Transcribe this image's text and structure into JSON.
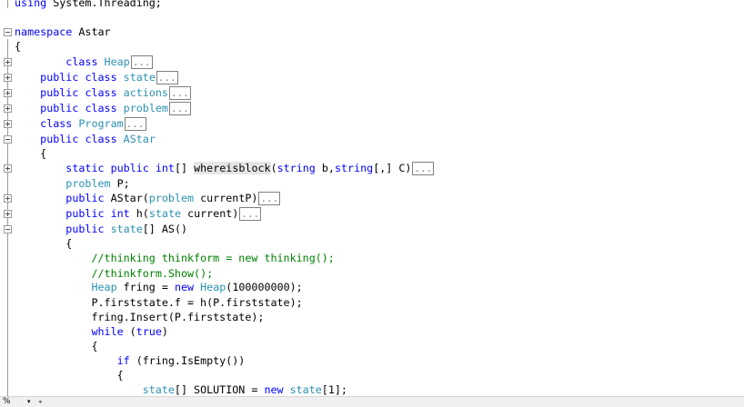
{
  "code_lines": [
    {
      "parts": [
        {
          "k": "using"
        },
        {
          "p": " System.Threading;"
        }
      ]
    },
    {
      "parts": [
        {
          "k": "namespace"
        },
        {
          "p": " Astar"
        }
      ]
    },
    {
      "parts": [
        {
          "p": "{"
        }
      ]
    },
    {
      "parts": [
        {
          "p": "        "
        },
        {
          "k": "class"
        },
        {
          "p": " "
        },
        {
          "t": "Heap"
        },
        {
          "box": "..."
        }
      ]
    },
    {
      "parts": [
        {
          "p": "    "
        },
        {
          "k": "public"
        },
        {
          "p": " "
        },
        {
          "k": "class"
        },
        {
          "p": " "
        },
        {
          "t": "state"
        },
        {
          "box": "..."
        }
      ]
    },
    {
      "parts": [
        {
          "p": "    "
        },
        {
          "k": "public"
        },
        {
          "p": " "
        },
        {
          "k": "class"
        },
        {
          "p": " "
        },
        {
          "t": "actions"
        },
        {
          "box": "..."
        }
      ]
    },
    {
      "parts": [
        {
          "p": "    "
        },
        {
          "k": "public"
        },
        {
          "p": " "
        },
        {
          "k": "class"
        },
        {
          "p": " "
        },
        {
          "t": "problem"
        },
        {
          "box": "..."
        }
      ]
    },
    {
      "parts": [
        {
          "p": "    "
        },
        {
          "k": "class"
        },
        {
          "p": " "
        },
        {
          "t": "Program"
        },
        {
          "box": "..."
        }
      ]
    },
    {
      "parts": [
        {
          "p": "    "
        },
        {
          "k": "public"
        },
        {
          "p": " "
        },
        {
          "k": "class"
        },
        {
          "p": " "
        },
        {
          "t": "AStar"
        }
      ]
    },
    {
      "parts": [
        {
          "p": "    {"
        }
      ]
    },
    {
      "parts": [
        {
          "p": "        "
        },
        {
          "k": "static"
        },
        {
          "p": " "
        },
        {
          "k": "public"
        },
        {
          "p": " "
        },
        {
          "k": "int"
        },
        {
          "p": "[] "
        },
        {
          "hl": "whereisblock"
        },
        {
          "p": "("
        },
        {
          "k": "string"
        },
        {
          "p": " b,"
        },
        {
          "k": "string"
        },
        {
          "p": "[,] C)"
        },
        {
          "box": "..."
        }
      ]
    },
    {
      "parts": [
        {
          "p": "        "
        },
        {
          "t": "problem"
        },
        {
          "p": " P;"
        }
      ]
    },
    {
      "parts": [
        {
          "p": "        "
        },
        {
          "k": "public"
        },
        {
          "p": " AStar("
        },
        {
          "t": "problem"
        },
        {
          "p": " currentP)"
        },
        {
          "box": "..."
        }
      ]
    },
    {
      "parts": [
        {
          "p": "        "
        },
        {
          "k": "public"
        },
        {
          "p": " "
        },
        {
          "k": "int"
        },
        {
          "p": " h("
        },
        {
          "t": "state"
        },
        {
          "p": " current)"
        },
        {
          "box": "..."
        }
      ]
    },
    {
      "parts": [
        {
          "p": "        "
        },
        {
          "k": "public"
        },
        {
          "p": " "
        },
        {
          "t": "state"
        },
        {
          "p": "[] AS()"
        }
      ]
    },
    {
      "parts": [
        {
          "p": "        {"
        }
      ]
    },
    {
      "parts": [
        {
          "p": "            "
        },
        {
          "c": "//thinking thinkform = new thinking();"
        }
      ]
    },
    {
      "parts": [
        {
          "p": "            "
        },
        {
          "c": "//thinkform.Show();"
        }
      ]
    },
    {
      "parts": [
        {
          "p": "            "
        },
        {
          "t": "Heap"
        },
        {
          "p": " fring = "
        },
        {
          "k": "new"
        },
        {
          "p": " "
        },
        {
          "t": "Heap"
        },
        {
          "p": "(100000000);"
        }
      ]
    },
    {
      "parts": [
        {
          "p": "            P.firststate.f = h(P.firststate);"
        }
      ]
    },
    {
      "parts": [
        {
          "p": "            fring.Insert(P.firststate);"
        }
      ]
    },
    {
      "parts": [
        {
          "p": "            "
        },
        {
          "k": "while"
        },
        {
          "p": " ("
        },
        {
          "k": "true"
        },
        {
          "p": ")"
        }
      ]
    },
    {
      "parts": [
        {
          "p": "            {"
        }
      ]
    },
    {
      "parts": [
        {
          "p": "                "
        },
        {
          "k": "if"
        },
        {
          "p": " (fring.IsEmpty())"
        }
      ]
    },
    {
      "parts": [
        {
          "p": "                {"
        }
      ]
    },
    {
      "parts": [
        {
          "p": "                    "
        },
        {
          "t": "state"
        },
        {
          "p": "[] SOLUTION = "
        },
        {
          "k": "new"
        },
        {
          "p": " "
        },
        {
          "t": "state"
        },
        {
          "p": "[1];"
        }
      ]
    }
  ],
  "status": {
    "zoom_label": "%",
    "zoom_arrow": "▾",
    "scroll_left": "◂"
  }
}
